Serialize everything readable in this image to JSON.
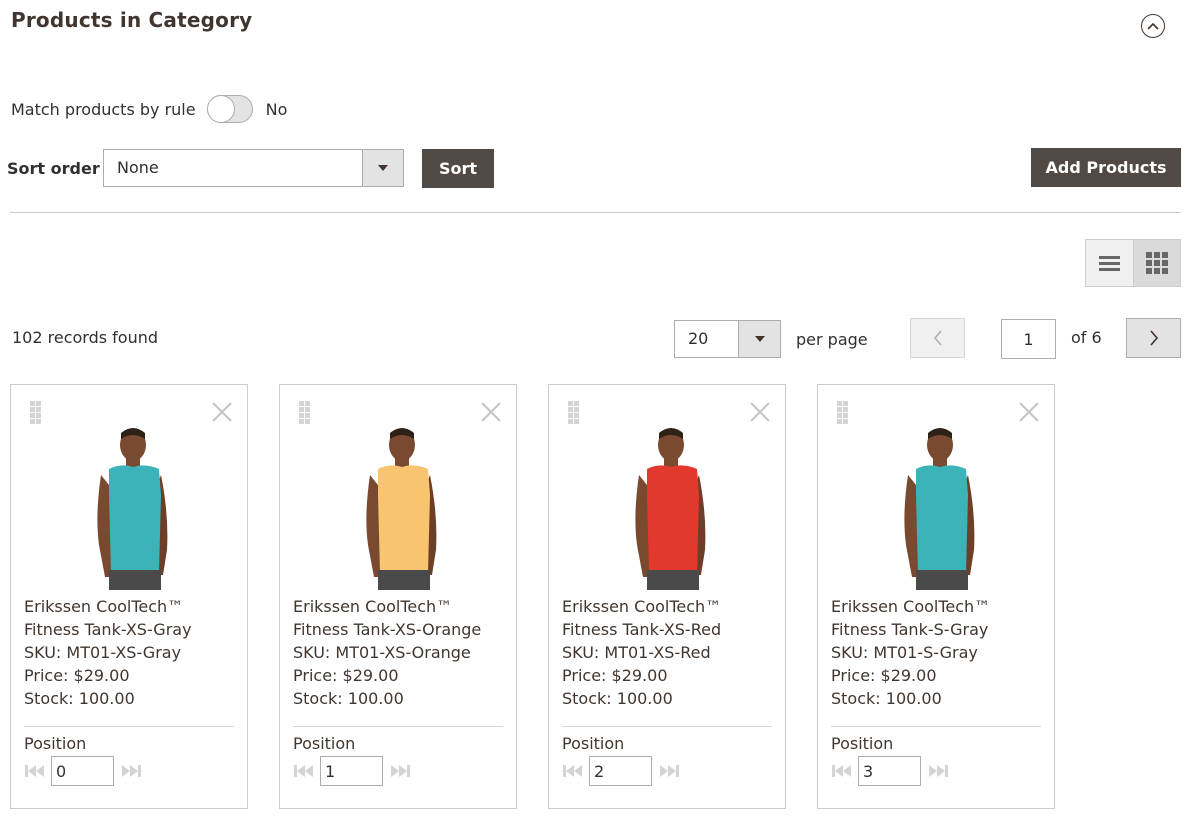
{
  "header": {
    "title": "Products in Category",
    "collapse_icon": "chevron-up-circle-icon"
  },
  "match_rule": {
    "label": "Match products by rule",
    "enabled": false,
    "state_label": "No"
  },
  "sort": {
    "label": "Sort order",
    "selected": "None",
    "button_label": "Sort"
  },
  "add_products_label": "Add Products",
  "view_mode": {
    "options": [
      "list",
      "grid"
    ],
    "active": "grid"
  },
  "records_found": "102 records found",
  "pagination": {
    "per_page": "20",
    "per_page_label": "per page",
    "current_page": "1",
    "total_label": "of 6"
  },
  "products": [
    {
      "name_line1": "Erikssen CoolTech™",
      "name_line2": "Fitness Tank-XS-Gray",
      "sku": "SKU: MT01-XS-Gray",
      "price": "Price: $29.00",
      "stock": "Stock: 100.00",
      "position_label": "Position",
      "position": "0",
      "shirt_color": "#3bb3b8"
    },
    {
      "name_line1": "Erikssen CoolTech™",
      "name_line2": "Fitness Tank-XS-Orange",
      "sku": "SKU: MT01-XS-Orange",
      "price": "Price: $29.00",
      "stock": "Stock: 100.00",
      "position_label": "Position",
      "position": "1",
      "shirt_color": "#f8c470"
    },
    {
      "name_line1": "Erikssen CoolTech™",
      "name_line2": "Fitness Tank-XS-Red",
      "sku": "SKU: MT01-XS-Red",
      "price": "Price: $29.00",
      "stock": "Stock: 100.00",
      "position_label": "Position",
      "position": "2",
      "shirt_color": "#e2382e"
    },
    {
      "name_line1": "Erikssen CoolTech™",
      "name_line2": "Fitness Tank-S-Gray",
      "sku": "SKU: MT01-S-Gray",
      "price": "Price: $29.00",
      "stock": "Stock: 100.00",
      "position_label": "Position",
      "position": "3",
      "shirt_color": "#3bb3b8"
    }
  ]
}
